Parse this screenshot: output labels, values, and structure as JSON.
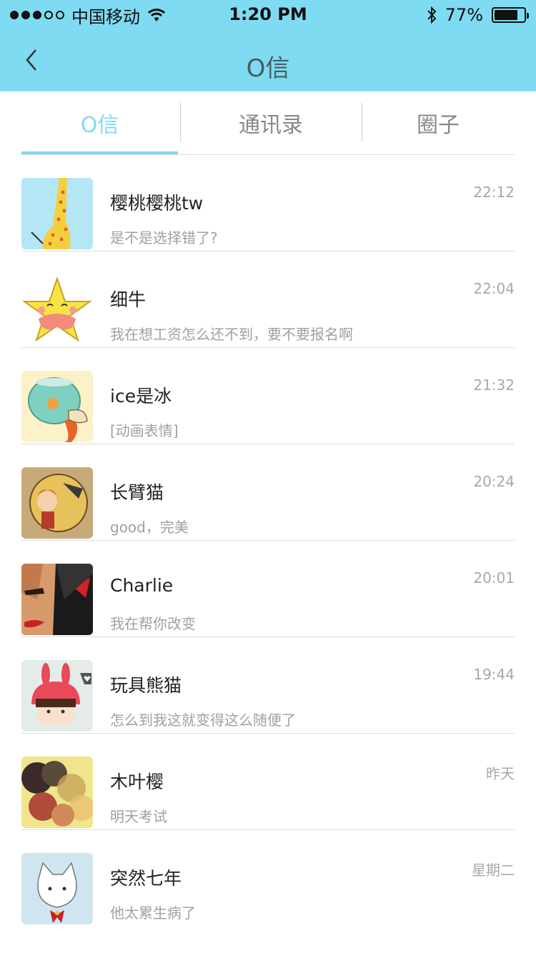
{
  "status_bar": {
    "signal_strength": "3 of 5",
    "carrier": "中国移动",
    "time": "1:20 PM",
    "battery_percent": "77%",
    "battery_level": 0.77
  },
  "nav": {
    "title": "O信"
  },
  "tabs": [
    {
      "label": "O信",
      "active": true
    },
    {
      "label": "通讯录",
      "active": false
    },
    {
      "label": "圈子",
      "active": false
    }
  ],
  "conversations": [
    {
      "name": "樱桃樱桃tw",
      "preview": "是不是选择错了?",
      "time": "22:12"
    },
    {
      "name": "细牛",
      "preview": "我在想工资怎么还不到，要不要报名啊",
      "time": "22:04"
    },
    {
      "name": "ice是冰",
      "preview": "[动画表情]",
      "time": "21:32"
    },
    {
      "name": "长臂猫",
      "preview": "good，完美",
      "time": "20:24"
    },
    {
      "name": "Charlie",
      "preview": "我在帮你改变",
      "time": "20:01"
    },
    {
      "name": "玩具熊猫",
      "preview": "怎么到我这就变得这么随便了",
      "time": "19:44"
    },
    {
      "name": "木叶樱",
      "preview": "明天考试",
      "time": "昨天"
    },
    {
      "name": "突然七年",
      "preview": "他太累生病了",
      "time": "星期二"
    }
  ],
  "colors": {
    "accent": "#7fdbf1",
    "divider": "#dddddd",
    "muted_text": "#a0a0a0"
  }
}
